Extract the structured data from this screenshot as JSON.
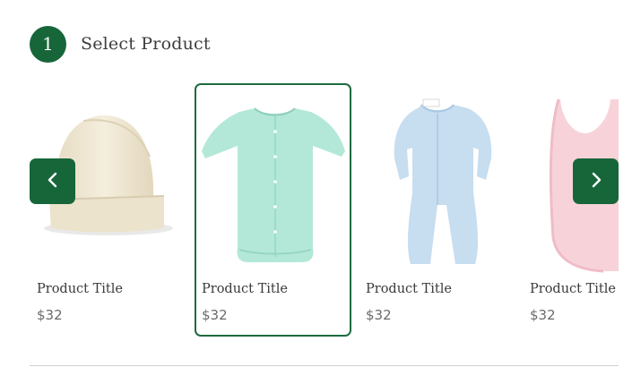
{
  "step": {
    "number": "1",
    "title": "Select Product"
  },
  "products": [
    {
      "title": "Product Title",
      "price": "$32",
      "image": "cream-knit-hat",
      "selected": false
    },
    {
      "title": "Product Title",
      "price": "$32",
      "image": "mint-baby-gown",
      "selected": true
    },
    {
      "title": "Product Title",
      "price": "$32",
      "image": "light-blue-footie",
      "selected": false
    },
    {
      "title": "Product Title",
      "price": "$32",
      "image": "pink-bib",
      "selected": false
    }
  ],
  "navigation": {
    "prev_icon": "chevron-left-icon",
    "next_icon": "chevron-right-icon"
  },
  "colors": {
    "accent": "#17663a",
    "selected_border": "#1e6b3f",
    "hat": "#efe7d3",
    "gown": "#b2e8d8",
    "footie": "#c6dcef",
    "bib": "#f6d2d8"
  }
}
